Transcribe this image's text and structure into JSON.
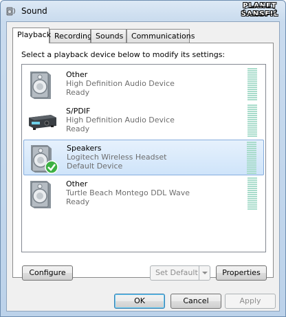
{
  "window": {
    "title": "Sound",
    "watermark_line1": "PLANET",
    "watermark_line2": "SANSFIL"
  },
  "tabs": [
    {
      "label": "Playback",
      "active": true
    },
    {
      "label": "Recording",
      "active": false
    },
    {
      "label": "Sounds",
      "active": false
    },
    {
      "label": "Communications",
      "active": false
    }
  ],
  "instruction": "Select a playback device below to modify its settings:",
  "devices": [
    {
      "name": "Other",
      "description": "High Definition Audio Device",
      "status": "Ready",
      "icon": "speaker-icon",
      "selected": false
    },
    {
      "name": "S/PDIF",
      "description": "High Definition Audio Device",
      "status": "Ready",
      "icon": "spdif-receiver-icon",
      "selected": false
    },
    {
      "name": "Speakers",
      "description": "Logitech Wireless Headset",
      "status": "Default Device",
      "icon": "speaker-icon",
      "selected": true,
      "default": true
    },
    {
      "name": "Other",
      "description": "Turtle Beach Montego DDL Wave",
      "status": "Ready",
      "icon": "speaker-icon",
      "selected": false
    }
  ],
  "panel_buttons": {
    "configure": "Configure",
    "set_default": "Set Default",
    "properties": "Properties"
  },
  "dialog_buttons": {
    "ok": "OK",
    "cancel": "Cancel",
    "apply": "Apply"
  },
  "colors": {
    "selection": "#cfe4fa",
    "meter": "#a8dccb",
    "default_check": "#3cb043"
  }
}
